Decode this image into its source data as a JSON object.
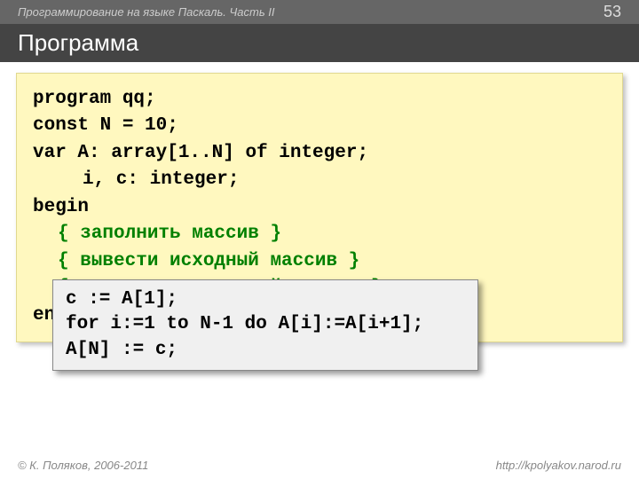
{
  "header": {
    "breadcrumb": "Программирование на языке Паскаль. Часть II",
    "page_number": "53"
  },
  "title": "Программа",
  "code": {
    "l1": "program qq;",
    "l2": "const N = 10;",
    "l3": "var A: array[1..N] of integer;",
    "l4": "i, c: integer;",
    "l5": "begin",
    "c1": "{ заполнить массив }",
    "c2": "{ вывести исходный массив }",
    "gap1": " ",
    "gap2": " ",
    "gap3": " ",
    "c3": "{ вывести полученный массив }",
    "l_end": "end."
  },
  "inset": {
    "l1": "c := A[1];",
    "l2": "for i:=1 to N-1 do A[i]:=A[i+1];",
    "l3": "A[N] := c;"
  },
  "footer": {
    "copyright": "© К. Поляков, 2006-2011",
    "url": "http://kpolyakov.narod.ru"
  }
}
